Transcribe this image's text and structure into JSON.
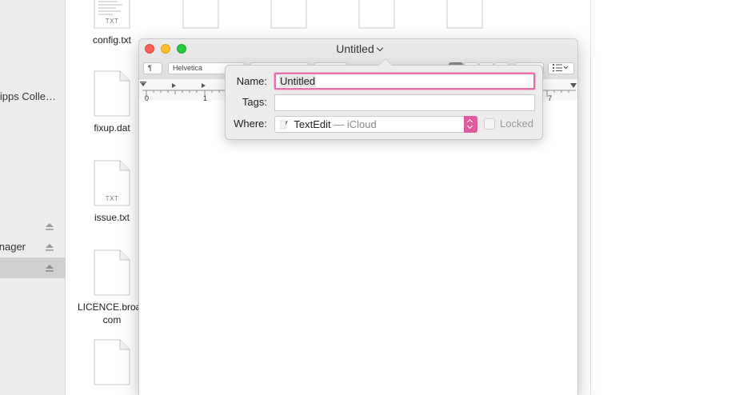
{
  "sidebar": {
    "items": [
      {
        "label": "ipps Colle…",
        "eject": false,
        "selected": false
      },
      {
        "label": "",
        "eject": true,
        "selected": false
      },
      {
        "label": "nager",
        "eject": true,
        "selected": false
      },
      {
        "label": "",
        "eject": true,
        "selected": true
      }
    ]
  },
  "files": [
    {
      "name": "config.txt",
      "tag": "TXT"
    },
    {
      "name": "fixup.dat",
      "tag": ""
    },
    {
      "name": "issue.txt",
      "tag": "TXT"
    },
    {
      "name": "LICENCE.broadcom",
      "tag": ""
    },
    {
      "name": "",
      "tag": ""
    }
  ],
  "window": {
    "title": "Untitled",
    "toolbar": {
      "paragraph": "¶",
      "font_family": "Helvetica"
    },
    "ruler": [
      "0",
      "1",
      "7"
    ]
  },
  "save_popover": {
    "name_label": "Name:",
    "name_value": "Untitled",
    "tags_label": "Tags:",
    "tags_value": "",
    "where_label": "Where:",
    "where_folder": "TextEdit",
    "where_location": "— iCloud",
    "locked_label": "Locked",
    "locked_checked": false
  },
  "colors": {
    "accent": "#e05aa0",
    "close": "#fc5f57",
    "minimize": "#fdbc2e",
    "zoom": "#28c840"
  }
}
